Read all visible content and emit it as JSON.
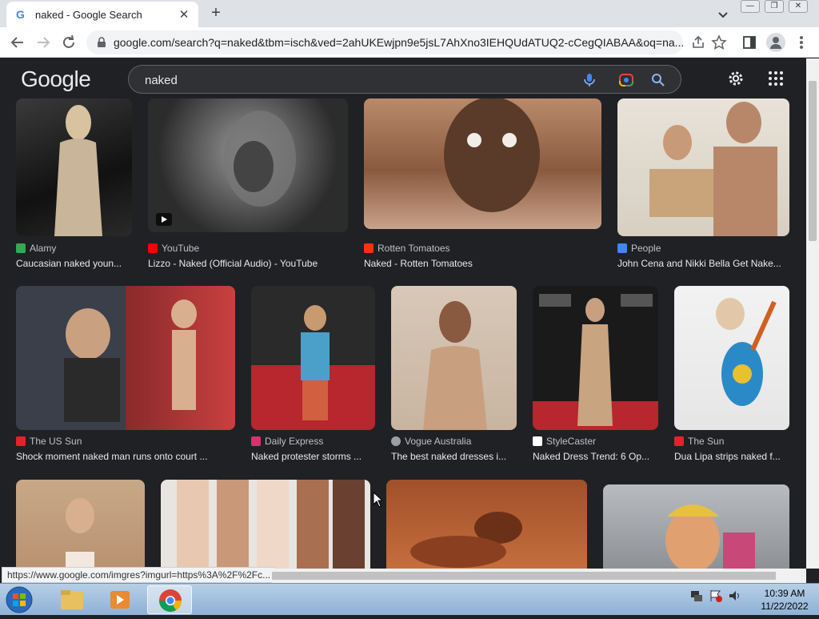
{
  "browser": {
    "tab_title": "naked - Google Search",
    "tab_close": "✕",
    "new_tab": "+",
    "url": "google.com/search?q=naked&tbm=isch&ved=2ahUKEwjpn9e5jsL7AhXno3IEHQUdATUQ2-cCegQIABAA&oq=na...",
    "win_min": "—",
    "win_restore": "❐",
    "win_close": "✕"
  },
  "google": {
    "logo": "Google",
    "query": "naked"
  },
  "results": {
    "row1": [
      {
        "source": "Alamy",
        "fav_color": "#34a853",
        "caption": "Caucasian naked youn..."
      },
      {
        "source": "YouTube",
        "fav_color": "#ff0000",
        "caption": "Lizzo - Naked (Official Audio) - YouTube"
      },
      {
        "source": "Rotten Tomatoes",
        "fav_color": "#fa320a",
        "caption": "Naked - Rotten Tomatoes"
      },
      {
        "source": "People",
        "fav_color": "#4285f4",
        "caption": "John Cena and Nikki Bella Get Nake..."
      }
    ],
    "row2": [
      {
        "source": "The US Sun",
        "fav_color": "#e8202a",
        "caption": "Shock moment naked man runs onto court ..."
      },
      {
        "source": "Daily Express",
        "fav_color": "#d6336c",
        "caption": "Naked protester storms ..."
      },
      {
        "source": "Vogue Australia",
        "fav_color": "#9aa0a6",
        "caption": "The best naked dresses i..."
      },
      {
        "source": "StyleCaster",
        "fav_color": "#ffffff",
        "caption": "Naked Dress Trend: 6 Op..."
      },
      {
        "source": "The Sun",
        "fav_color": "#e8202a",
        "caption": "Dua Lipa strips naked f..."
      }
    ]
  },
  "status_url": "https://www.google.com/imgres?imgurl=https%3A%2F%2Fc...",
  "clock": {
    "time": "10:39 AM",
    "date": "11/22/2022"
  }
}
